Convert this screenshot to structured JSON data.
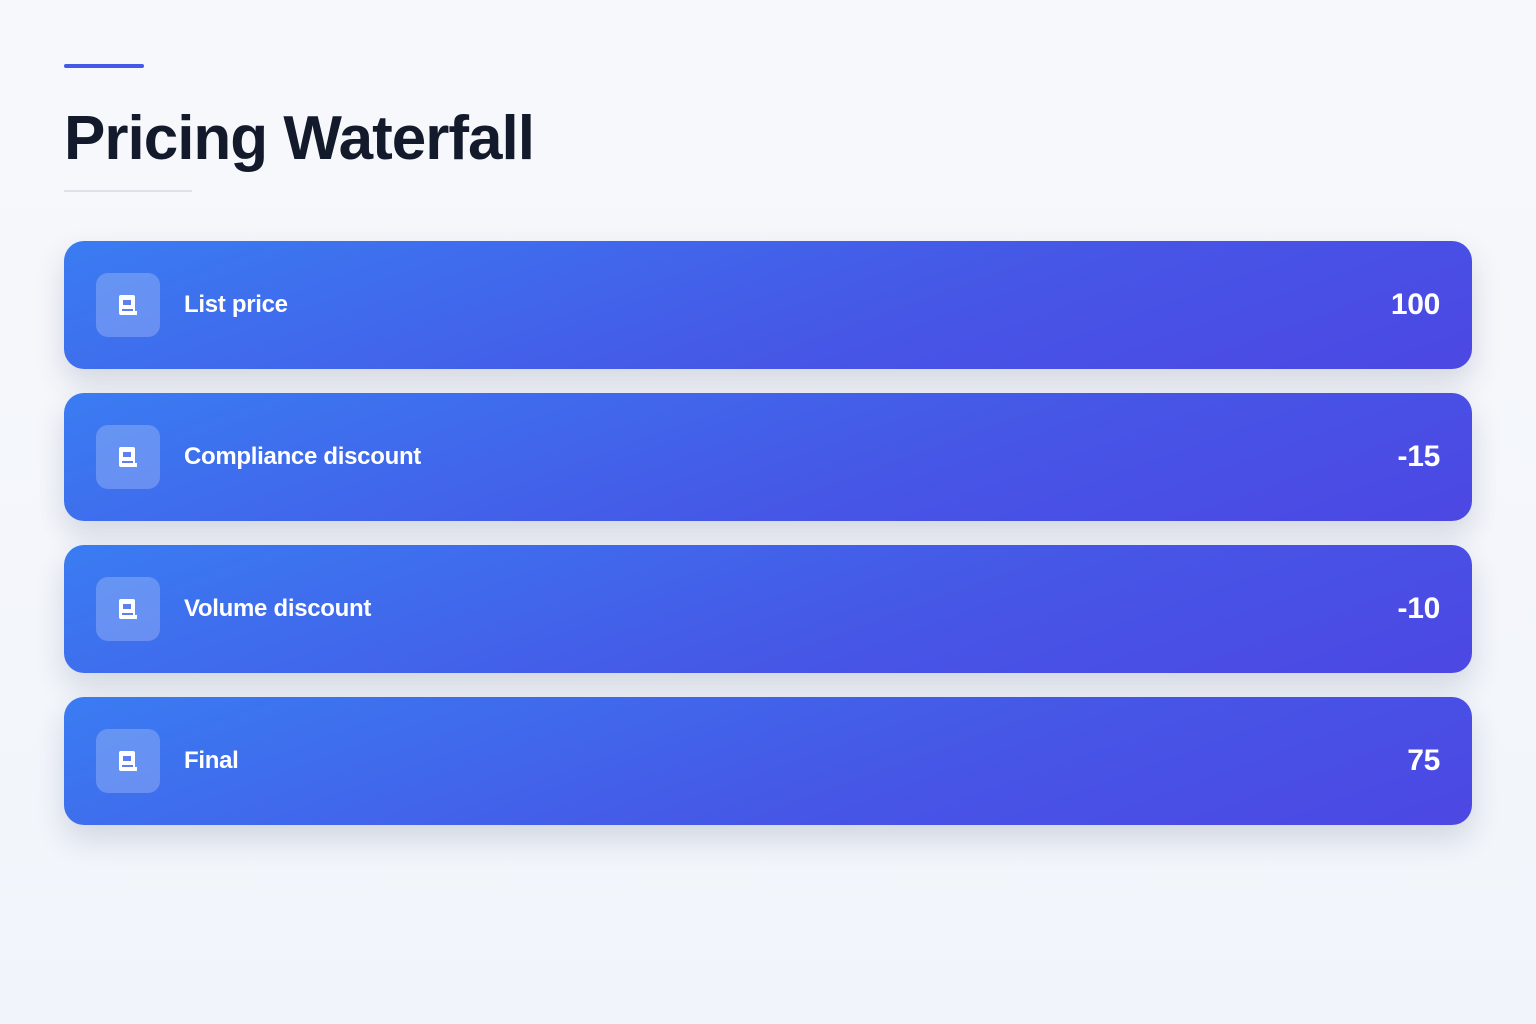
{
  "page": {
    "title": "Pricing Waterfall"
  },
  "colors": {
    "accent": "#4459e6",
    "row_gradient_start": "#3a7cf2",
    "row_gradient_end": "#4c47e3",
    "title_text": "#121a2b"
  },
  "rows": [
    {
      "label": "List price",
      "value": "100",
      "icon": "receipt-icon"
    },
    {
      "label": "Compliance discount",
      "value": "-15",
      "icon": "receipt-icon"
    },
    {
      "label": "Volume discount",
      "value": "-10",
      "icon": "receipt-icon"
    },
    {
      "label": "Final",
      "value": "75",
      "icon": "receipt-icon"
    }
  ]
}
